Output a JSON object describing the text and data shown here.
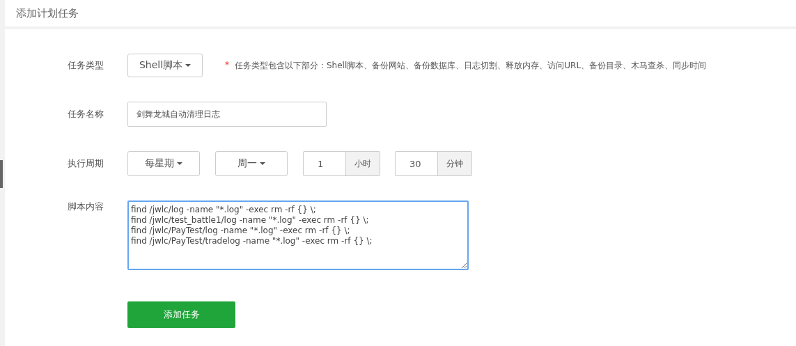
{
  "header": {
    "title": "添加计划任务"
  },
  "form": {
    "task_type": {
      "label": "任务类型",
      "value": "Shell脚本",
      "hint_mark": "*",
      "hint": "任务类型包含以下部分：Shell脚本、备份网站、备份数据库、日志切割、释放内存、访问URL、备份目录、木马查杀、同步时间"
    },
    "task_name": {
      "label": "任务名称",
      "value": "剑舞龙城自动清理日志"
    },
    "period": {
      "label": "执行周期",
      "controls": [
        {
          "kind": "select",
          "value": "每星期"
        },
        {
          "kind": "select",
          "value": "周一"
        },
        {
          "kind": "addon",
          "value": "1",
          "unit": "小时"
        },
        {
          "kind": "addon",
          "value": "30",
          "unit": "分钟"
        }
      ]
    },
    "script": {
      "label": "脚本内容",
      "value": "find /jwlc/log -name \"*.log\" -exec rm -rf {} \\;\nfind /jwlc/test_battle1/log -name \"*.log\" -exec rm -rf {} \\;\nfind /jwlc/PayTest/log -name \"*.log\" -exec rm -rf {} \\;\nfind /jwlc/PayTest/tradelog -name \"*.log\" -exec rm -rf {} \\;",
      "focused": true
    },
    "submit": {
      "label": "添加任务"
    }
  }
}
